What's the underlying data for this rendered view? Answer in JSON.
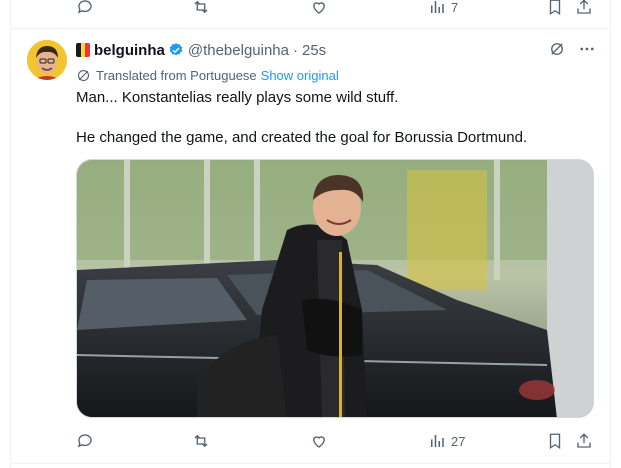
{
  "prev_tweet_actions": {
    "views_count": "7"
  },
  "tweet": {
    "author": {
      "display_name": "belguinha",
      "handle": "@thebelguinha",
      "verified": true,
      "flag": "belgium-flag"
    },
    "separator": "·",
    "time": "25s",
    "translation": {
      "label": "Translated from Portuguese",
      "link": "Show original"
    },
    "text_line_1": "Man... Konstantelias really plays some wild stuff.",
    "text_line_2": "He changed the game, and created the goal for Borussia Dortmund.",
    "actions": {
      "views_count": "27"
    }
  },
  "colors": {
    "text_primary": "#0f1419",
    "text_secondary": "#536471",
    "link": "#1d9bf0",
    "verified": "#1d9bf0",
    "border": "#eff3f4"
  }
}
